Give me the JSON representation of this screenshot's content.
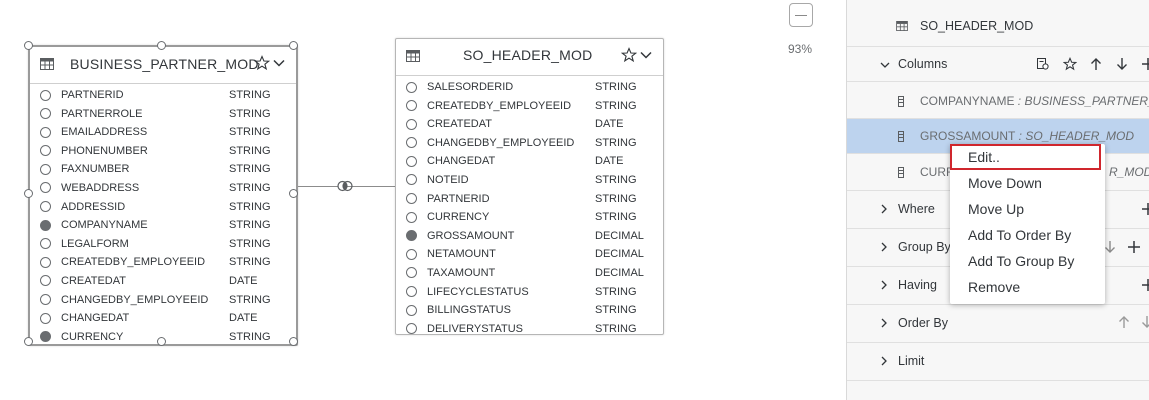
{
  "canvas": {
    "zoom_level": "93%",
    "tables": [
      {
        "title": "BUSINESS_PARTNER_MOD",
        "columns": [
          {
            "name": "PARTNERID",
            "type": "STRING",
            "selected": false
          },
          {
            "name": "PARTNERROLE",
            "type": "STRING",
            "selected": false
          },
          {
            "name": "EMAILADDRESS",
            "type": "STRING",
            "selected": false
          },
          {
            "name": "PHONENUMBER",
            "type": "STRING",
            "selected": false
          },
          {
            "name": "FAXNUMBER",
            "type": "STRING",
            "selected": false
          },
          {
            "name": "WEBADDRESS",
            "type": "STRING",
            "selected": false
          },
          {
            "name": "ADDRESSID",
            "type": "STRING",
            "selected": false
          },
          {
            "name": "COMPANYNAME",
            "type": "STRING",
            "selected": true
          },
          {
            "name": "LEGALFORM",
            "type": "STRING",
            "selected": false
          },
          {
            "name": "CREATEDBY_EMPLOYEEID",
            "type": "STRING",
            "selected": false
          },
          {
            "name": "CREATEDAT",
            "type": "DATE",
            "selected": false
          },
          {
            "name": "CHANGEDBY_EMPLOYEEID",
            "type": "STRING",
            "selected": false
          },
          {
            "name": "CHANGEDAT",
            "type": "DATE",
            "selected": false
          },
          {
            "name": "CURRENCY",
            "type": "STRING",
            "selected": true
          }
        ]
      },
      {
        "title": "SO_HEADER_MOD",
        "columns": [
          {
            "name": "SALESORDERID",
            "type": "STRING",
            "selected": false
          },
          {
            "name": "CREATEDBY_EMPLOYEEID",
            "type": "STRING",
            "selected": false
          },
          {
            "name": "CREATEDAT",
            "type": "DATE",
            "selected": false
          },
          {
            "name": "CHANGEDBY_EMPLOYEEID",
            "type": "STRING",
            "selected": false
          },
          {
            "name": "CHANGEDAT",
            "type": "DATE",
            "selected": false
          },
          {
            "name": "NOTEID",
            "type": "STRING",
            "selected": false
          },
          {
            "name": "PARTNERID",
            "type": "STRING",
            "selected": false
          },
          {
            "name": "CURRENCY",
            "type": "STRING",
            "selected": false
          },
          {
            "name": "GROSSAMOUNT",
            "type": "DECIMAL",
            "selected": true
          },
          {
            "name": "NETAMOUNT",
            "type": "DECIMAL",
            "selected": false
          },
          {
            "name": "TAXAMOUNT",
            "type": "DECIMAL",
            "selected": false
          },
          {
            "name": "LIFECYCLESTATUS",
            "type": "STRING",
            "selected": false
          },
          {
            "name": "BILLINGSTATUS",
            "type": "STRING",
            "selected": false
          },
          {
            "name": "DELIVERYSTATUS",
            "type": "STRING",
            "selected": false
          }
        ]
      }
    ]
  },
  "side_panel": {
    "source_table": "SO_HEADER_MOD",
    "columns_section": {
      "label": "Columns",
      "items": [
        {
          "name": "COMPANYNAME",
          "source": " : BUSINESS_PARTNER_..."
        },
        {
          "name": "GROSSAMOUNT",
          "source": " : SO_HEADER_MOD"
        },
        {
          "name": "CURR",
          "source": "R_MOD"
        }
      ]
    },
    "sections": {
      "where": "Where",
      "group_by": "Group By",
      "having": "Having",
      "order_by": "Order By",
      "limit": "Limit"
    }
  },
  "context_menu": {
    "items": [
      "Edit..",
      "Move Down",
      "Move Up",
      "Add To Order By",
      "Add To Group By",
      "Remove"
    ]
  },
  "colors": {
    "highlight_row": "#bdd3ee",
    "focus_border": "#d0262d",
    "text": "#32363a"
  }
}
